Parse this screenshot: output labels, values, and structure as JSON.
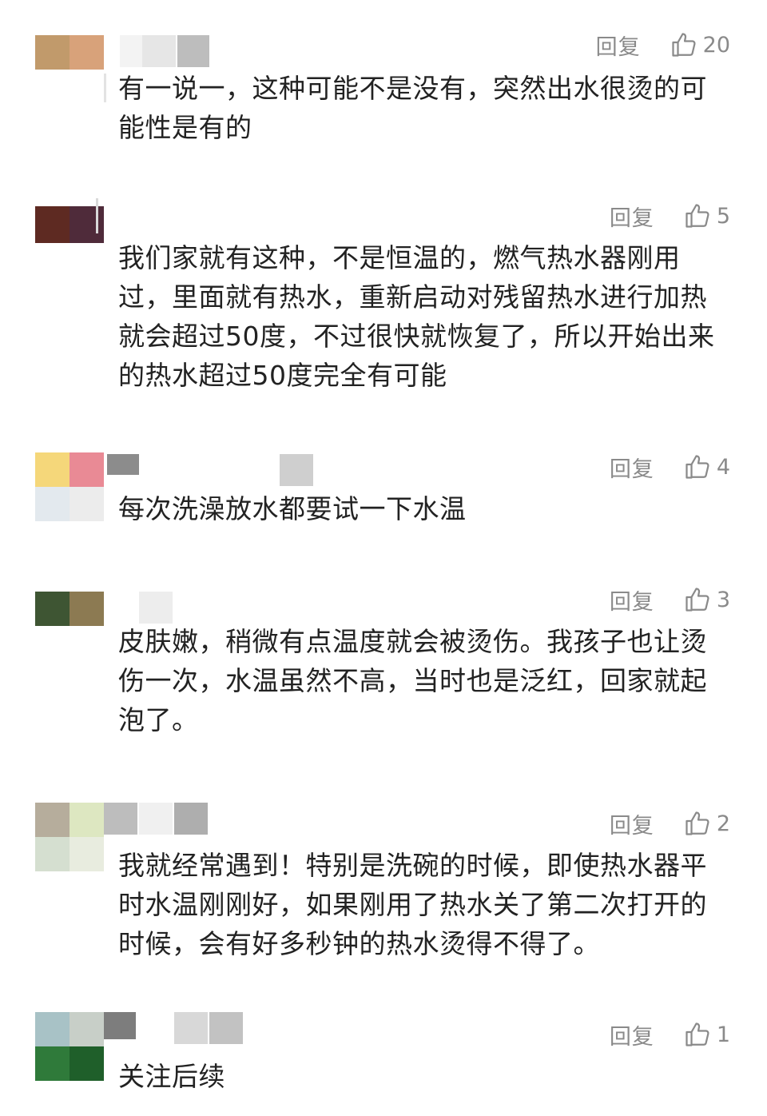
{
  "comments": [
    {
      "reply_label": "回复",
      "likes": "20",
      "text": "有一说一，这种可能不是没有，突然出水很烫的可能性是有的"
    },
    {
      "reply_label": "回复",
      "likes": "5",
      "text": "我们家就有这种，不是恒温的，燃气热水器刚用过，里面就有热水，重新启动对残留热水进行加热就会超过50度，不过很快就恢复了，所以开始出来的热水超过50度完全有可能"
    },
    {
      "reply_label": "回复",
      "likes": "4",
      "text": "每次洗澡放水都要试一下水温"
    },
    {
      "reply_label": "回复",
      "likes": "3",
      "text": "皮肤嫩，稍微有点温度就会被烫伤。我孩子也让烫伤一次，水温虽然不高，当时也是泛红，回家就起泡了。"
    },
    {
      "reply_label": "回复",
      "likes": "2",
      "text": "我就经常遇到！特别是洗碗的时候，即使热水器平时水温刚刚好，如果刚用了热水关了第二次打开的时候，会有好多秒钟的热水烫得不得了。"
    },
    {
      "reply_label": "回复",
      "likes": "1",
      "text": "关注后续"
    }
  ],
  "colors": {
    "text": "#222222",
    "muted": "#8a8a8a",
    "background": "#ffffff"
  },
  "icons": {
    "like": "thumbs-up-icon",
    "avatar": "pixelated-avatar"
  }
}
